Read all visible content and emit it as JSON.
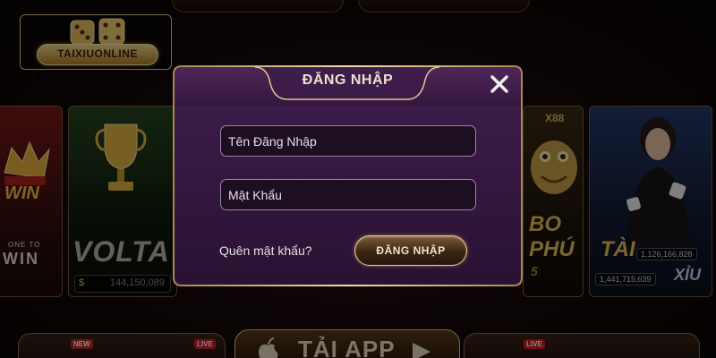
{
  "brand": {
    "logo_text": "TAIXIUONLINE"
  },
  "background_games": [
    {
      "big_text": "WIN",
      "small_text": "ONE TO",
      "small_text_2": "WIN"
    },
    {
      "big_text": "VOLTA",
      "jackpot": "144,150,089"
    },
    {
      "big_text": "X88",
      "partial_1": "BO",
      "partial_2": "PHÚ",
      "partial_3": "5"
    },
    {
      "big_text": "TÀI",
      "small_text": "XỈU",
      "num_1": "1,126,166,828",
      "num_2": "1,441,715,639"
    }
  ],
  "bottom_nav": {
    "new_badge": "NEW",
    "live_badge": "LIVE",
    "download_label": "TẢI APP"
  },
  "modal": {
    "title": "ĐĂNG NHẬP",
    "username_placeholder": "Tên Đăng Nhập",
    "password_placeholder": "Mật Khẩu",
    "forgot_label": "Quên mật khẩu?",
    "login_label": "ĐĂNG NHẬP"
  },
  "colors": {
    "accent_gold": "#e9c98a",
    "modal_purple": "#3a1a47",
    "background_dark": "#0e0707"
  },
  "icons": [
    "dice-icon",
    "close-icon",
    "trophy-icon",
    "apple-icon",
    "android-icon"
  ]
}
